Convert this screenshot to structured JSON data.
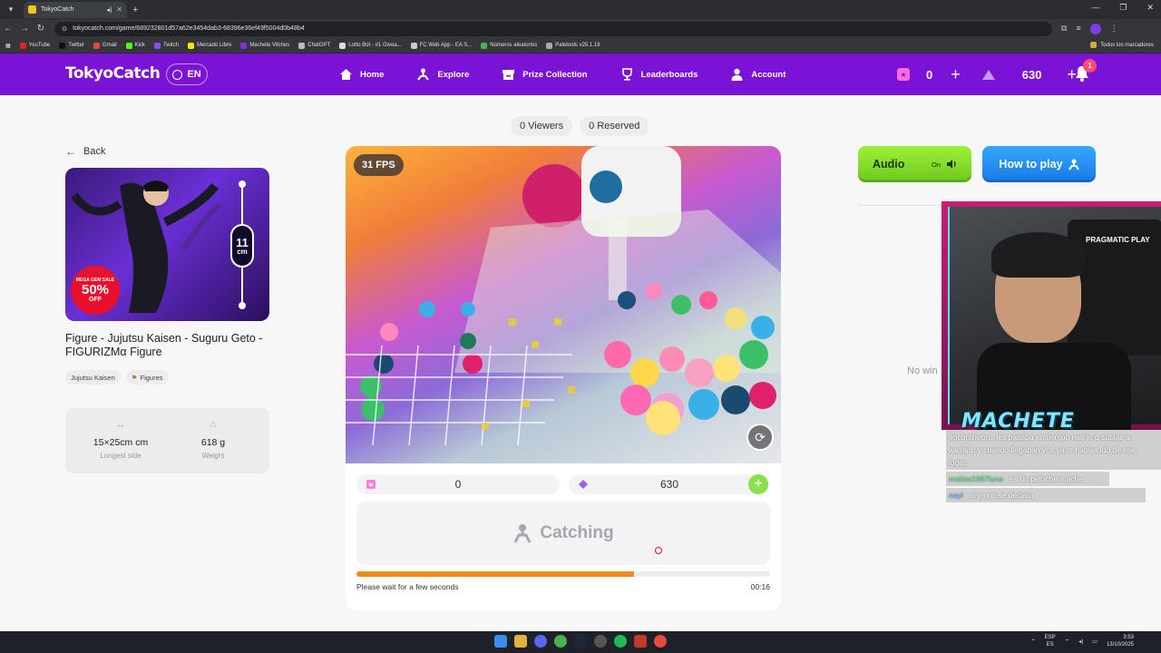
{
  "browser": {
    "tab_title": "TokyoCatch",
    "url": "tokyocatch.com/game/689232801d57a62e3454dab3-68396e36ef49f5004d0b48b4",
    "bookmarks": [
      "YouTube",
      "Twitter",
      "Gmail",
      "Kick",
      "Twitch",
      "Mercado Libre",
      "Machete Vilches",
      "ChatGPT",
      "Lotto Bot - #1 Givea...",
      "FC Web App - EA S...",
      "Números aleatorios",
      "Paletools v25.1.19"
    ],
    "all_bookmarks": "Todos los marcadores"
  },
  "header": {
    "logo": "TokyoCatch",
    "lang": "EN",
    "nav": [
      {
        "label": "Home",
        "icon": "home-icon"
      },
      {
        "label": "Explore",
        "icon": "claw-icon"
      },
      {
        "label": "Prize Collection",
        "icon": "box-icon"
      },
      {
        "label": "Leaderboards",
        "icon": "trophy-icon"
      },
      {
        "label": "Account",
        "icon": "user-icon"
      }
    ],
    "tickets": "0",
    "gems": "630",
    "notifications": "1"
  },
  "viewers": {
    "viewers": "0 Viewers",
    "reserved": "0 Reserved"
  },
  "product": {
    "back": "Back",
    "sale_line1": "MEGA GEM SALE",
    "sale_pct": "50%",
    "sale_off": "OFF",
    "height_value": "11",
    "height_unit": "cm",
    "title": "Figure - Jujutsu Kaisen - Suguru Geto - FIGURIZMα Figure",
    "tags": [
      "Jujutsu Kaisen",
      "Figures"
    ],
    "specs": {
      "size_value": "15×25cm cm",
      "size_label": "Longest side",
      "weight_value": "618 g",
      "weight_label": "Weight"
    }
  },
  "stream": {
    "fps": "31 FPS",
    "tickets": "0",
    "gems": "630",
    "status": "Catching",
    "progress": 0.67,
    "wait_text": "Please wait for a few seconds",
    "timer": "00:16"
  },
  "side": {
    "audio_label": "Audio",
    "audio_state": "On",
    "howto_label": "How to play",
    "no_winners": "No win"
  },
  "overlay": {
    "chair_brand": "PRAGMATIC PLAY",
    "streamer_name": "MACHETE",
    "chat": [
      {
        "user": "",
        "text": "encontraron.. les pasaba en tiempo real lo q subias a wasapp y cuando llegaban vos ya te habias ido de ese lugar.."
      },
      {
        "user": "matias1987luna",
        "text": ": es un peluche mache"
      },
      {
        "user": "nayl",
        "text": ": si ya no se declara"
      }
    ]
  },
  "taskbar": {
    "lang": "ESP",
    "region": "ES",
    "time": "3:53",
    "date": "13/10/2025"
  },
  "colors": {
    "brand": "#7a13d6",
    "progress": "#f08a1c",
    "audio": "#8be04e",
    "howto": "#2a8ff5"
  }
}
